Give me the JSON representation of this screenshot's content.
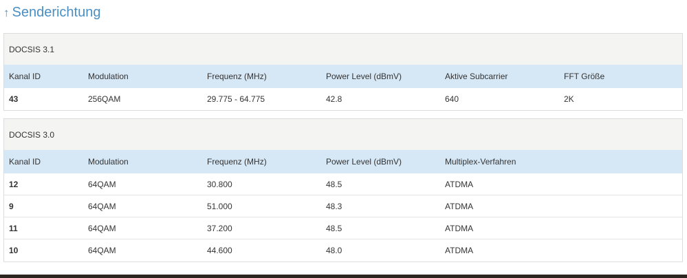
{
  "section": {
    "arrow": "↑",
    "title": "Senderichtung"
  },
  "docsis31": {
    "title": "DOCSIS 3.1",
    "headers": [
      "Kanal ID",
      "Modulation",
      "Frequenz (MHz)",
      "Power Level (dBmV)",
      "Aktive Subcarrier",
      "FFT Größe"
    ],
    "rows": [
      [
        "43",
        "256QAM",
        "29.775 - 64.775",
        "42.8",
        "640",
        "2K"
      ]
    ]
  },
  "docsis30": {
    "title": "DOCSIS 3.0",
    "headers": [
      "Kanal ID",
      "Modulation",
      "Frequenz (MHz)",
      "Power Level (dBmV)",
      "Multiplex-Verfahren"
    ],
    "rows": [
      [
        "12",
        "64QAM",
        "30.800",
        "48.5",
        "ATDMA"
      ],
      [
        "9",
        "64QAM",
        "51.000",
        "48.3",
        "ATDMA"
      ],
      [
        "11",
        "64QAM",
        "37.200",
        "48.5",
        "ATDMA"
      ],
      [
        "10",
        "64QAM",
        "44.600",
        "48.0",
        "ATDMA"
      ]
    ]
  },
  "colors": {
    "accent": "#4a8ec2",
    "header_row": "#d6e7f5",
    "panel_title_bg": "#f4f4f2"
  }
}
